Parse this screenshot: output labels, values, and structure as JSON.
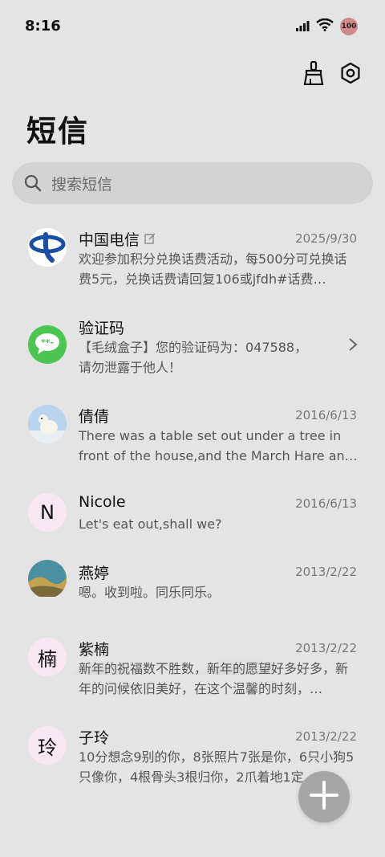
{
  "status": {
    "time": "8:16",
    "battery": "100"
  },
  "header": {
    "title": "短信"
  },
  "search": {
    "placeholder": "搜索短信"
  },
  "conversations": [
    {
      "name": "中国电信",
      "date": "2025/9/30",
      "preview": "欢迎参加积分兑换话费活动，每500分可兑换话费5元，兑换话费请回复106或jfdh#话费…"
    },
    {
      "name": "验证码",
      "date": "",
      "preview": "【毛绒盒子】您的验证码为：047588，请勿泄露于他人！"
    },
    {
      "name": "倩倩",
      "date": "2016/6/13",
      "preview": "There was a table set out under a tree in front of the house,and the March Hare an…"
    },
    {
      "name": "Nicole",
      "date": "2016/6/13",
      "preview": "Let's eat out,shall we?",
      "avatar_letter": "N"
    },
    {
      "name": "燕婷",
      "date": "2013/2/22",
      "preview": "嗯。收到啦。同乐同乐。"
    },
    {
      "name": "紫楠",
      "date": "2013/2/22",
      "preview": "新年的祝福数不胜数，新年的愿望好多好多，新年的问候依旧美好，在这个温馨的时刻，…",
      "avatar_letter": "楠"
    },
    {
      "name": "子玲",
      "date": "2013/2/22",
      "preview": "10分想念9别的你，8张照片7张是你，6只小狗5只像你，4根骨头3根归你，2爪着地1定…",
      "avatar_letter": "玲"
    }
  ],
  "colors": {
    "accent_blue": "#1a4fa3",
    "green": "#4cc552",
    "avatar_pink": "#f8e6f2",
    "fab": "#a6a6a6"
  }
}
